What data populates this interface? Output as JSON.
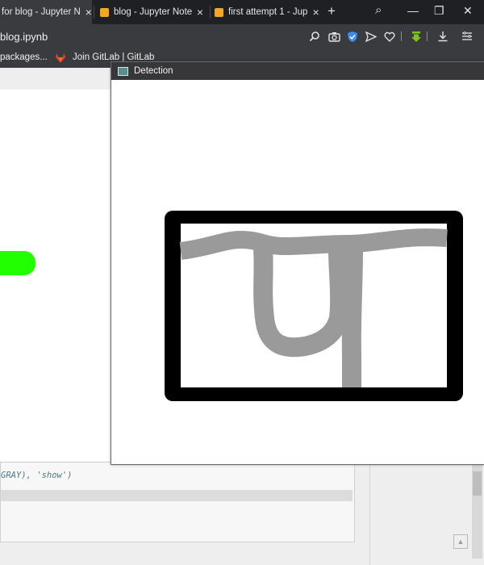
{
  "tabs": [
    {
      "title": "for blog - Jupyter N",
      "close": "×",
      "active": true
    },
    {
      "title": "blog - Jupyter Note",
      "close": "×",
      "active": false
    },
    {
      "title": "first attempt 1 - Jup",
      "close": "×",
      "active": false
    }
  ],
  "new_tab": "+",
  "window_controls": {
    "search": "⌕",
    "minimize": "—",
    "restore": "❐",
    "close": "✕"
  },
  "address": {
    "text": "blog.ipynb"
  },
  "toolbar_icons": [
    "zoom-icon",
    "camera-icon",
    "shield-icon",
    "send-icon",
    "heart-icon",
    "download-arrow-icon",
    "download-icon",
    "menu-icon"
  ],
  "bookmarks": [
    {
      "label": "packages..."
    },
    {
      "label": "Join GitLab | GitLab"
    }
  ],
  "detection_window": {
    "title": "Detection",
    "frame_color": "#000000",
    "stroke_color": "#9a9a9a"
  },
  "notebook": {
    "code_text": "GRAY), 'show')",
    "accent_green": "#22ff00"
  }
}
